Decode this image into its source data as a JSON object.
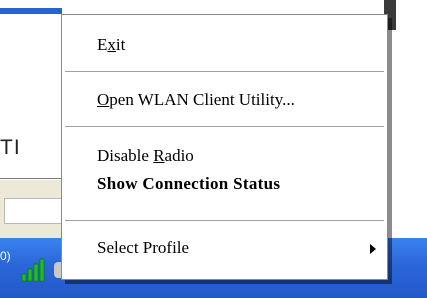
{
  "background": {
    "partial_text": "TI"
  },
  "taskbar": {
    "tray_partial_text": "0)"
  },
  "context_menu": {
    "items": [
      {
        "pre": "E",
        "accel": "x",
        "post": "it"
      },
      {
        "pre": "",
        "accel": "O",
        "post": "pen WLAN Client Utility..."
      },
      {
        "pre": "Disable ",
        "accel": "R",
        "post": "adio"
      },
      {
        "label": "Show Connection Status"
      },
      {
        "label": "Select Profile"
      }
    ]
  },
  "colors": {
    "taskbar": "#2a67d9",
    "menu_background": "#ffffff",
    "signal_green": "#1fbf1f"
  },
  "icons": {
    "signal": "signal-strength-icon",
    "submenu": "submenu-arrow-icon"
  }
}
